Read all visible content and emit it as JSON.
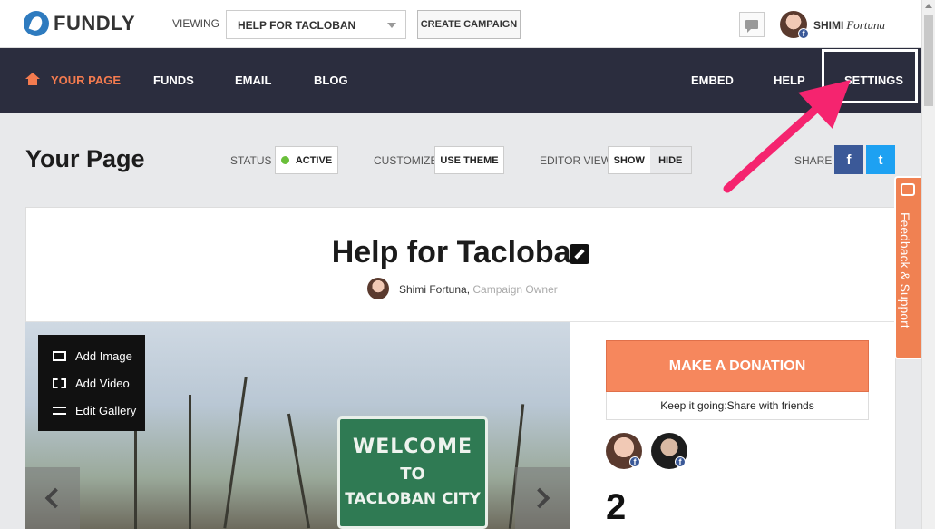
{
  "header": {
    "logo": "FUNDLY",
    "viewing_label": "VIEWING",
    "campaign_select": "HELP FOR TACLOBAN",
    "create_button": "CREATE CAMPAIGN",
    "user_first": "SHIMI",
    "user_last": "Fortuna",
    "badge": "f"
  },
  "nav": {
    "your_page": "YOUR PAGE",
    "funds": "FUNDS",
    "email": "EMAIL",
    "blog": "BLOG",
    "embed": "EMBED",
    "help": "HELP",
    "settings": "SETTINGS"
  },
  "toolbar": {
    "title": "Your Page",
    "status_label": "STATUS",
    "status_value": "ACTIVE",
    "customize_label": "CUSTOMIZE",
    "use_theme": "USE THEME",
    "editor_view_label": "EDITOR VIEW",
    "show": "SHOW",
    "hide": "HIDE",
    "share_label": "SHARE",
    "facebook": "f",
    "twitter": "t"
  },
  "campaign": {
    "title": "Help for Tacloban",
    "owner_name": "Shimi Fortuna,",
    "owner_role": "Campaign Owner"
  },
  "gallery": {
    "add_image": "Add Image",
    "add_video": "Add Video",
    "edit_gallery": "Edit Gallery",
    "sign_line1": "WELCOME",
    "sign_line2": "TO",
    "sign_line3": "TACLOBAN CITY"
  },
  "donation": {
    "button": "MAKE A DONATION",
    "keep_going_prefix": "Keep it going: ",
    "keep_going_link": "Share with friends",
    "count": "2"
  },
  "feedback": {
    "label": "Feedback & Support"
  },
  "colors": {
    "accent": "#f47b4f",
    "nav_bg": "#2b2d3e",
    "annotation_arrow": "#f5246f"
  }
}
